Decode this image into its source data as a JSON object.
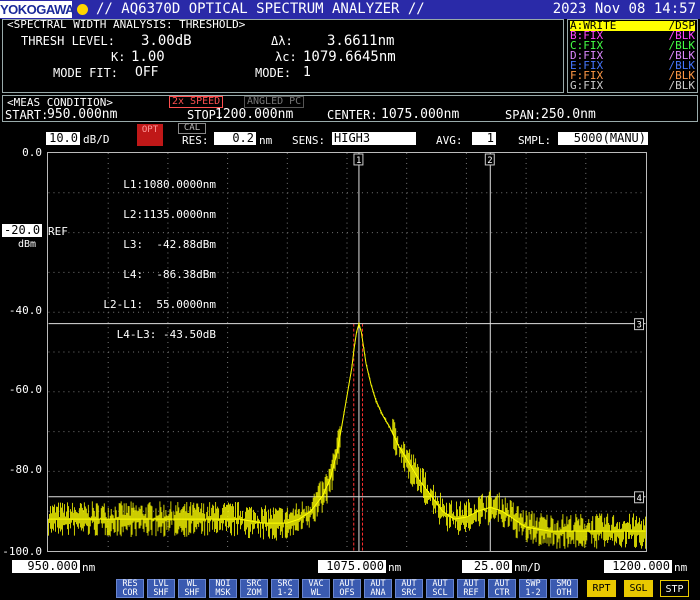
{
  "header": {
    "brand": "YOKOGAWA",
    "title": "// AQ6370D OPTICAL SPECTRUM ANALYZER //",
    "datetime": "2023 Nov 08 14:57"
  },
  "analysis": {
    "title": "<SPECTRAL WIDTH ANALYSIS: THRESHOLD>",
    "thresh_label": "THRESH LEVEL:",
    "thresh_value": "3.00dB",
    "k_label": "K:",
    "k_value": "1.00",
    "mode_fit_label": "MODE FIT:",
    "mode_fit_value": "OFF",
    "dl_label": "Δλ:",
    "dl_value": "3.6611nm",
    "lc_label": "λc:",
    "lc_value": "1079.6645nm",
    "mode_label": "MODE:",
    "mode_value": "1"
  },
  "traces": [
    {
      "name": "A:WRITE",
      "state": "/DSP",
      "color": "#ffff00",
      "highlight": true
    },
    {
      "name": "B:FIX",
      "state": "/BLK",
      "color": "#ff44ff",
      "highlight": false
    },
    {
      "name": "C:FIX",
      "state": "/BLK",
      "color": "#44ff44",
      "highlight": false
    },
    {
      "name": "D:FIX",
      "state": "/BLK",
      "color": "#dd88ff",
      "highlight": false
    },
    {
      "name": "E:FIX",
      "state": "/BLK",
      "color": "#4477ff",
      "highlight": false
    },
    {
      "name": "F:FIX",
      "state": "/BLK",
      "color": "#ff9944",
      "highlight": false
    },
    {
      "name": "G:FIX",
      "state": "/BLK",
      "color": "#cccccc",
      "highlight": false
    }
  ],
  "meas": {
    "title": "<MEAS CONDITION>",
    "speed_badge": "2x SPEED",
    "angled_badge": "ANGLED PC",
    "start_label": "START:",
    "start_value": "950.000nm",
    "stop_label": "STOP:",
    "stop_value": "1200.000nm",
    "center_label": "CENTER:",
    "center_value": "1075.000nm",
    "span_label": "SPAN:",
    "span_value": "250.0nm"
  },
  "settings": {
    "scale_value": "10.0",
    "scale_unit": "dB/D",
    "opt_badge": "OPT",
    "cal_badge": "CAL",
    "res_label": "RES:",
    "res_value": "0.2",
    "res_unit": "nm",
    "sens_label": "SENS:",
    "sens_value": "HIGH3",
    "avg_label": "AVG:",
    "avg_value": "1",
    "smpl_label": "SMPL:",
    "smpl_value": "5000(MANU)"
  },
  "yaxis": {
    "ticks": [
      "0.0",
      "-40.0",
      "-60.0",
      "-80.0",
      "-100.0"
    ],
    "ref_value": "-20.0",
    "ref_label": "REF",
    "unit": "dBm"
  },
  "markers_readout": [
    "L1:1080.0000nm",
    "L2:1135.0000nm",
    "L3:  -42.88dBm",
    "L4:  -86.38dBm",
    "L2-L1:  55.0000nm",
    "L4-L3: -43.50dB"
  ],
  "marker_labels": {
    "v1": "1",
    "v2": "2",
    "h3": "3",
    "h4": "4"
  },
  "xaxis": {
    "start_value": "950.000",
    "start_unit": "nm",
    "center_value": "1075.000",
    "center_unit": "nm",
    "div_value": "25.00",
    "div_unit": "nm/D",
    "stop_value": "1200.000",
    "stop_unit": "nm"
  },
  "softkeys": [
    {
      "l1": "RES",
      "l2": "COR"
    },
    {
      "l1": "LVL",
      "l2": "SHF"
    },
    {
      "l1": "WL",
      "l2": "SHF"
    },
    {
      "l1": "NOI",
      "l2": "MSK"
    },
    {
      "l1": "SRC",
      "l2": "ZOM"
    },
    {
      "l1": "SRC",
      "l2": "1-2"
    },
    {
      "l1": "VAC",
      "l2": "WL"
    },
    {
      "l1": "AUT",
      "l2": "OFS"
    },
    {
      "l1": "AUT",
      "l2": "ANA"
    },
    {
      "l1": "AUT",
      "l2": "SRC"
    },
    {
      "l1": "AUT",
      "l2": "SCL"
    },
    {
      "l1": "AUT",
      "l2": "REF"
    },
    {
      "l1": "AUT",
      "l2": "CTR"
    },
    {
      "l1": "SWP",
      "l2": "1-2"
    },
    {
      "l1": "SMO",
      "l2": "OTH"
    }
  ],
  "run_buttons": {
    "rpt": "RPT",
    "sgl": "SGL",
    "stp": "STP"
  },
  "chart_data": {
    "type": "line",
    "x_unit": "nm",
    "y_unit": "dBm",
    "xlim": [
      950,
      1200
    ],
    "ylim": [
      -100,
      0
    ],
    "trace_color": "#ffff00",
    "grid": true,
    "series": [
      {
        "name": "A:WRITE",
        "x": [
          950,
          960,
          970,
          980,
          990,
          1000,
          1010,
          1020,
          1030,
          1040,
          1050,
          1055,
          1060,
          1065,
          1068,
          1071,
          1073,
          1075,
          1077,
          1078,
          1079,
          1080,
          1081,
          1082,
          1083,
          1085,
          1087,
          1090,
          1093,
          1096,
          1100,
          1105,
          1110,
          1115,
          1120,
          1125,
          1130,
          1135,
          1140,
          1145,
          1150,
          1160,
          1170,
          1180,
          1190,
          1200
        ],
        "y": [
          -92,
          -92,
          -92,
          -92,
          -92,
          -92,
          -92,
          -92,
          -92,
          -93,
          -93,
          -92,
          -90,
          -86,
          -82,
          -75,
          -68,
          -61,
          -54,
          -49,
          -45,
          -42.9,
          -45,
          -49,
          -53,
          -58,
          -62,
          -66,
          -69,
          -73,
          -77,
          -82,
          -86,
          -90,
          -92,
          -91.5,
          -90,
          -89,
          -90,
          -92,
          -94,
          -95,
          -95,
          -95,
          -95,
          -95
        ]
      }
    ],
    "markers": {
      "L1": 1080.0,
      "L2": 1135.0,
      "L3": -42.88,
      "L4": -86.38,
      "L2-L1": 55.0,
      "L4-L3": -43.5
    },
    "threshold_lines_nm": [
      1077.83,
      1081.5
    ]
  }
}
